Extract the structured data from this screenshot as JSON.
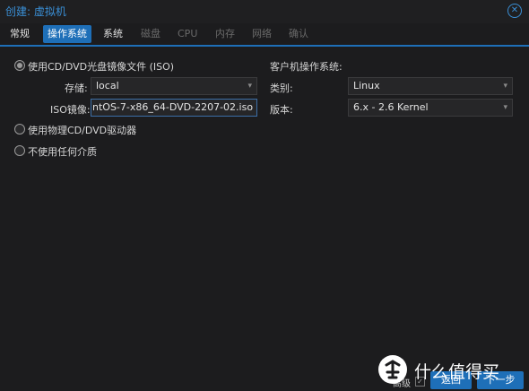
{
  "window": {
    "title": "创建: 虚拟机",
    "close_icon": "close-icon"
  },
  "tabs": [
    {
      "label": "常规",
      "state": "normal"
    },
    {
      "label": "操作系统",
      "state": "active"
    },
    {
      "label": "系统",
      "state": "normal"
    },
    {
      "label": "磁盘",
      "state": "disabled"
    },
    {
      "label": "CPU",
      "state": "disabled"
    },
    {
      "label": "内存",
      "state": "disabled"
    },
    {
      "label": "网络",
      "state": "disabled"
    },
    {
      "label": "确认",
      "state": "disabled"
    }
  ],
  "media": {
    "option_iso": "使用CD/DVD光盘镜像文件 (ISO)",
    "storage_label": "存储:",
    "storage_value": "local",
    "iso_label": "ISO镜像:",
    "iso_value": "ntOS-7-x86_64-DVD-2207-02.iso",
    "option_physical": "使用物理CD/DVD驱动器",
    "option_none": "不使用任何介质",
    "selected": "iso"
  },
  "guest_os": {
    "heading": "客户机操作系统:",
    "type_label": "类别:",
    "type_value": "Linux",
    "version_label": "版本:",
    "version_value": "6.x - 2.6 Kernel"
  },
  "footer": {
    "advanced_label": "高级",
    "advanced_checked": true,
    "back_label": "返回",
    "next_label": "下一步"
  },
  "watermark": {
    "text": "什么值得买",
    "icon": "smzdm-logo-icon"
  },
  "colors": {
    "accent": "#1e6fb8",
    "title": "#3a8fd6",
    "background": "#1c1c1e"
  }
}
